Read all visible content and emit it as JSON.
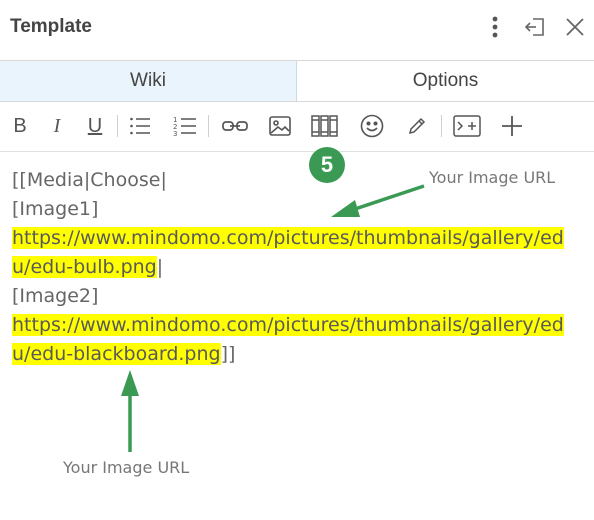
{
  "window": {
    "title": "Template"
  },
  "tabs": [
    {
      "label": "Wiki",
      "active": true
    },
    {
      "label": "Options",
      "active": false
    }
  ],
  "toolbar": {
    "bold": "B",
    "italic": "I",
    "underline": "U",
    "buttons": [
      "bold",
      "italic",
      "underline",
      "bullet-list",
      "numbered-list",
      "link",
      "image",
      "library",
      "emoji",
      "pencil",
      "code",
      "add"
    ]
  },
  "editor": {
    "lines": [
      "[[Media|Choose|",
      "[Image1]",
      "https://www.mindomo.com/pictures/thumbnails/gallery/ed",
      "u/edu-bulb.png",
      "|",
      "[Image2]",
      "https://www.mindomo.com/pictures/thumbnails/gallery/ed",
      "u/edu-blackboard.png",
      "]]"
    ]
  },
  "annotations": {
    "badge": "5",
    "label_top": "Your Image URL",
    "label_bottom": "Your Image URL",
    "color": "#3a9a53"
  }
}
